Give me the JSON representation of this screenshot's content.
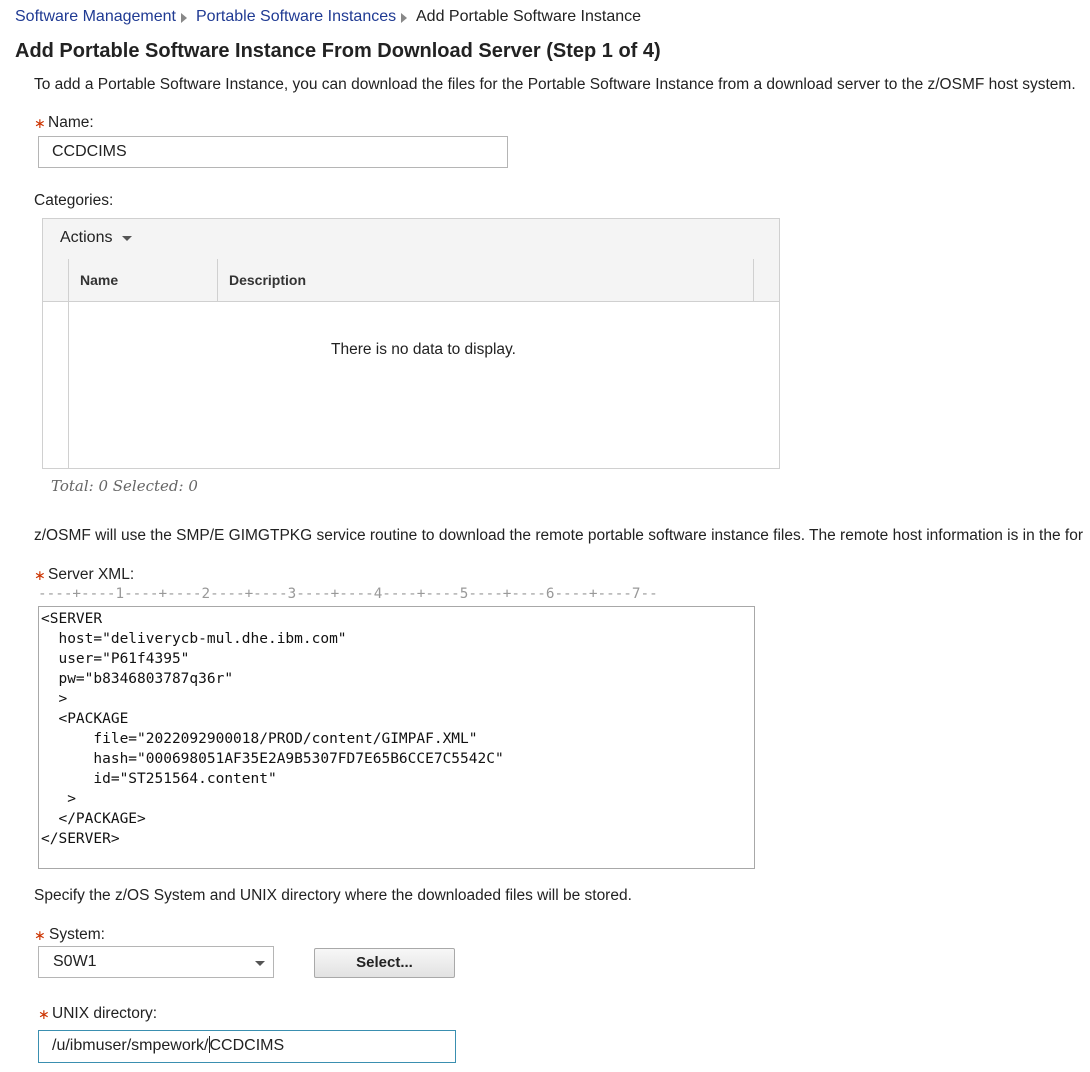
{
  "breadcrumb": {
    "items": [
      {
        "label": "Software Management"
      },
      {
        "label": "Portable Software Instances"
      }
    ],
    "current": "Add Portable Software Instance"
  },
  "page_title": "Add Portable Software Instance From Download Server (Step 1 of 4)",
  "intro_text": "To add a Portable Software Instance, you can download the files for the Portable Software Instance from a download server to the z/OSMF host system.",
  "required_marker": "∗",
  "name_field": {
    "label": "Name:",
    "value": "CCDCIMS"
  },
  "categories": {
    "label": "Categories:",
    "actions_label": "Actions",
    "columns": [
      "Name",
      "Description"
    ],
    "empty_message": "There is no data to display.",
    "footer": "Total: 0 Selected: 0"
  },
  "gimgtpkg_text": "z/OSMF will use the SMP/E GIMGTPKG service routine to download the remote portable software instance files. The remote host information is in the for",
  "server_xml": {
    "label": "Server XML:",
    "ruler": "----+----1----+----2----+----3----+----4----+----5----+----6----+----7--",
    "lines": [
      "<SERVER",
      "  host=\"deliverycb-mul.dhe.ibm.com\"",
      "  user=\"P61f4395\"",
      "  pw=\"b8346803787q36r\"",
      "  >",
      "  <PACKAGE",
      "      file=\"2022092900018/PROD/content/GIMPAF.XML\"",
      "      hash=\"000698051AF35E2A9B5307FD7E65B6CCE7C5542C\"",
      "      id=\"ST251564.content\"",
      "   >",
      "  </PACKAGE>",
      "</SERVER>"
    ]
  },
  "specify_text": "Specify the z/OS System and UNIX directory where the downloaded files will be stored.",
  "system_field": {
    "label": "System:",
    "value": "S0W1",
    "select_button": "Select..."
  },
  "unix_field": {
    "label": "UNIX directory:",
    "value_before_cursor": "/u/ibmuser/smpework/",
    "value_after_cursor": "CCDCIMS"
  },
  "colors": {
    "link": "#1f3a93",
    "required": "#cc3300",
    "focus_border": "#3a8fb0"
  }
}
